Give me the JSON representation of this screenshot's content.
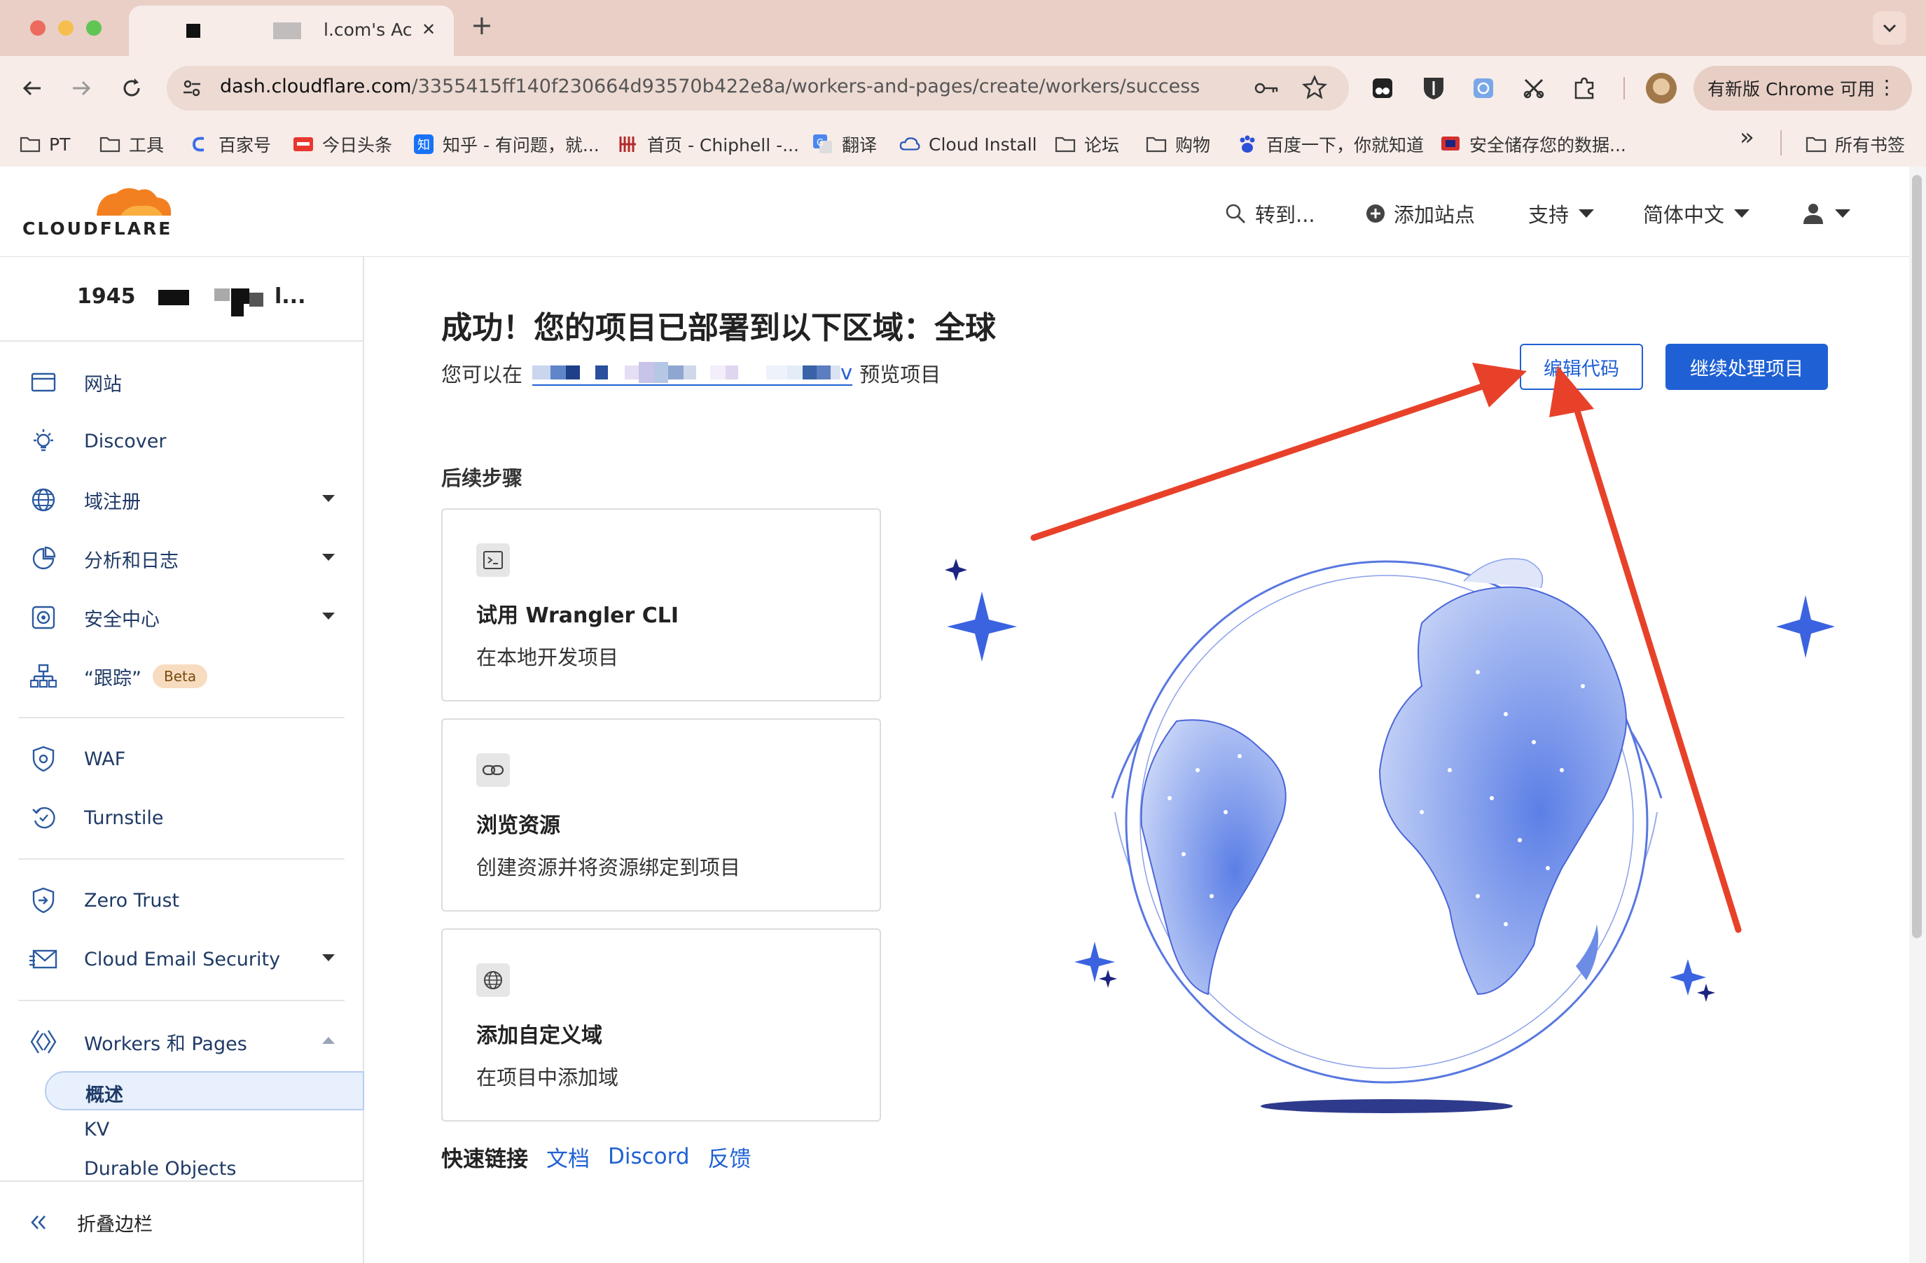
{
  "browser": {
    "tab": {
      "title": "l.com's Ac",
      "close": "✕"
    },
    "new_tab": "+",
    "url": {
      "host": "dash.cloudflare.com",
      "path": "/3355415ff140f230664d93570b422e8a/workers-and-pages/create/workers/success"
    },
    "update_button": "有新版 Chrome 可用",
    "more_bookmarks": "»",
    "bookmarks": [
      "PT",
      "工具",
      "百家号",
      "今日头条",
      "知乎 - 有问题，就...",
      "首页 - Chiphell -...",
      "翻译",
      "Cloud Install",
      "论坛",
      "购物",
      "百度一下，你就知道",
      "安全储存您的数据..."
    ],
    "all_bookmarks": "所有书签"
  },
  "header": {
    "logo_text": "CLOUDFLARE",
    "goto": "转到...",
    "add_site": "添加站点",
    "support": "支持",
    "language": "简体中文"
  },
  "sidebar": {
    "account": "1945",
    "account_suffix": "l...",
    "items": [
      {
        "label": "网站"
      },
      {
        "label": "Discover"
      },
      {
        "label": "域注册"
      },
      {
        "label": "分析和日志"
      },
      {
        "label": "安全中心"
      },
      {
        "label": "“跟踪”",
        "badge": "Beta"
      },
      {
        "label": "WAF"
      },
      {
        "label": "Turnstile"
      },
      {
        "label": "Zero Trust"
      },
      {
        "label": "Cloud Email Security"
      },
      {
        "label": "Workers 和 Pages"
      }
    ],
    "sub_items": [
      "概述",
      "KV",
      "Durable Objects"
    ],
    "collapse": "折叠边栏"
  },
  "main": {
    "title": "成功！您的项目已部署到以下区域：全球",
    "preview_prefix": "您可以在",
    "preview_link_tail": "v",
    "preview_suffix": "预览项目",
    "edit_code_button": "编辑代码",
    "continue_button": "继续处理项目",
    "next_steps_heading": "后续步骤",
    "cards": [
      {
        "title": "试用 Wrangler CLI",
        "desc": "在本地开发项目"
      },
      {
        "title": "浏览资源",
        "desc": "创建资源并将资源绑定到项目"
      },
      {
        "title": "添加自定义域",
        "desc": "在项目中添加域"
      }
    ],
    "quick_links_label": "快速链接",
    "quick_links": [
      "文档",
      "Discord",
      "反馈"
    ]
  },
  "colors": {
    "accent": "#1f61d4",
    "cloudflare_orange": "#f38020",
    "annotation_red": "#e8412a",
    "nav_text": "#1f3a66"
  }
}
